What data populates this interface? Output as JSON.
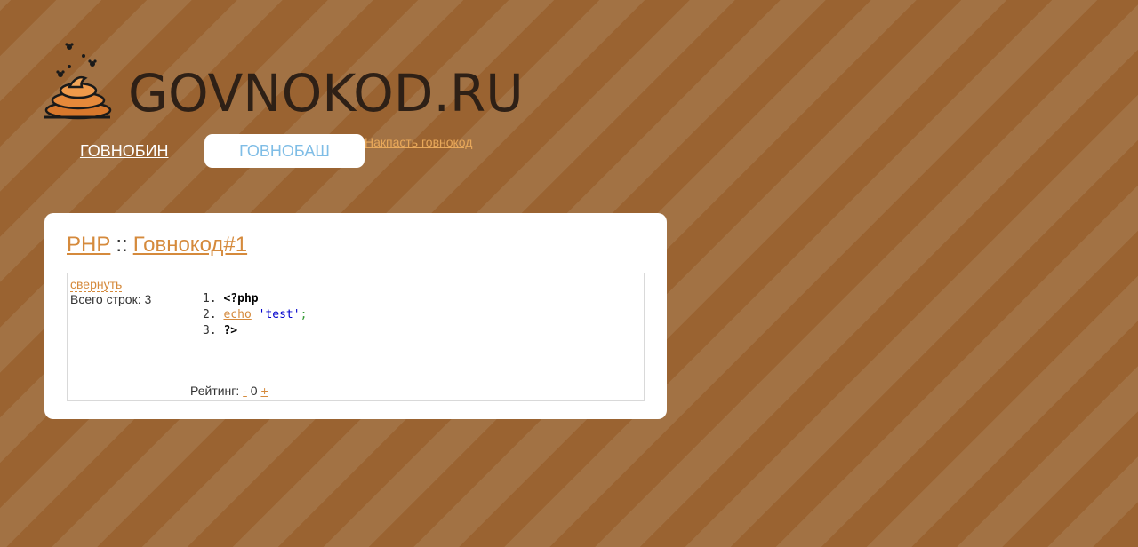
{
  "header": {
    "logo_text": "GOVNOKOD.RU",
    "nav": {
      "pastebin_label": "ГОВНОБИН",
      "bash_label": "ГОВНОБАШ",
      "add_label": "Накпасть говнокод"
    }
  },
  "snippet": {
    "language": "PHP",
    "separator": "::",
    "title": "Говнокод#1",
    "collapse_label": "свернуть",
    "lines_label": "Всего строк: 3",
    "code": [
      {
        "num": "1.",
        "text": "<?php"
      },
      {
        "num": "2.",
        "keyword": "echo",
        "string": "'test'",
        "end": ";"
      },
      {
        "num": "3.",
        "text": "?>"
      }
    ],
    "rating": {
      "label": "Рейтинг:",
      "minus": "-",
      "value": "0",
      "plus": "+"
    }
  },
  "colors": {
    "background": "#9a6331",
    "stripe": "#a27244",
    "link": "#d58a3c",
    "active_tab_text": "#7fbde6"
  },
  "icons": {
    "logo": "poop-icon"
  }
}
